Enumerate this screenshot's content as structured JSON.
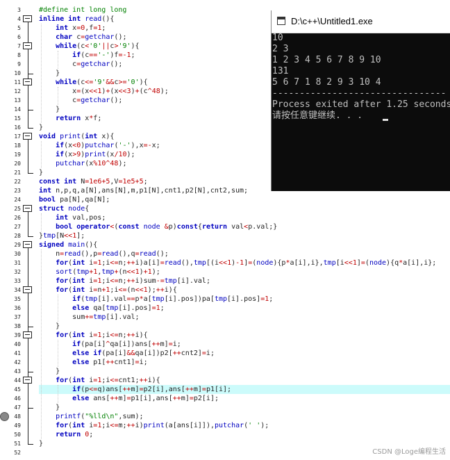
{
  "editor": {
    "code_lines": [
      {
        "n": "3",
        "text": "#define int long long"
      },
      {
        "n": "4",
        "text": "inline int read(){"
      },
      {
        "n": "5",
        "text": "    int x=0,f=1;"
      },
      {
        "n": "6",
        "text": "    char c=getchar();"
      },
      {
        "n": "7",
        "text": "    while(c<'0'||c>'9'){"
      },
      {
        "n": "8",
        "text": "        if(c=='-')f=-1;"
      },
      {
        "n": "9",
        "text": "        c=getchar();"
      },
      {
        "n": "10",
        "text": "    }"
      },
      {
        "n": "11",
        "text": "    while(c<='9'&&c>='0'){"
      },
      {
        "n": "12",
        "text": "        x=(x<<1)+(x<<3)+(c^48);"
      },
      {
        "n": "13",
        "text": "        c=getchar();"
      },
      {
        "n": "14",
        "text": "    }"
      },
      {
        "n": "15",
        "text": "    return x*f;"
      },
      {
        "n": "16",
        "text": "}"
      },
      {
        "n": "17",
        "text": "void print(int x){"
      },
      {
        "n": "18",
        "text": "    if(x<0)putchar('-'),x=-x;"
      },
      {
        "n": "19",
        "text": "    if(x>9)print(x/10);"
      },
      {
        "n": "20",
        "text": "    putchar(x%10^48);"
      },
      {
        "n": "21",
        "text": "}"
      },
      {
        "n": "22",
        "text": "const int N=1e6+5,V=1e5+5;"
      },
      {
        "n": "23",
        "text": "int n,p,q,a[N],ans[N],m,p1[N],cnt1,p2[N],cnt2,sum;"
      },
      {
        "n": "24",
        "text": "bool pa[N],qa[N];"
      },
      {
        "n": "25",
        "text": "struct node{"
      },
      {
        "n": "26",
        "text": "    int val,pos;"
      },
      {
        "n": "27",
        "text": "    bool operator<(const node &p)const{return val<p.val;}"
      },
      {
        "n": "28",
        "text": "}tmp[N<<1];"
      },
      {
        "n": "29",
        "text": "signed main(){"
      },
      {
        "n": "30",
        "text": "    n=read(),p=read(),q=read();"
      },
      {
        "n": "31",
        "text": "    for(int i=1;i<=n;++i)a[i]=read(),tmp[(i<<1)-1]=(node){p*a[i],i},tmp[i<<1]=(node){q*a[i],i};"
      },
      {
        "n": "32",
        "text": "    sort(tmp+1,tmp+(n<<1)+1);"
      },
      {
        "n": "33",
        "text": "    for(int i=1;i<=n;++i)sum-=tmp[i].val;"
      },
      {
        "n": "34",
        "text": "    for(int i=n+1;i<=(n<<1);++i){"
      },
      {
        "n": "35",
        "text": "        if(tmp[i].val==p*a[tmp[i].pos])pa[tmp[i].pos]=1;"
      },
      {
        "n": "36",
        "text": "        else qa[tmp[i].pos]=1;"
      },
      {
        "n": "37",
        "text": "        sum+=tmp[i].val;"
      },
      {
        "n": "38",
        "text": "    }"
      },
      {
        "n": "39",
        "text": "    for(int i=1;i<=n;++i){"
      },
      {
        "n": "40",
        "text": "        if(pa[i]^qa[i])ans[++m]=i;"
      },
      {
        "n": "41",
        "text": "        else if(pa[i]&&qa[i])p2[++cnt2]=i;"
      },
      {
        "n": "42",
        "text": "        else p1[++cnt1]=i;"
      },
      {
        "n": "43",
        "text": "    }"
      },
      {
        "n": "44",
        "text": "    for(int i=1;i<=cnt1;++i){"
      },
      {
        "n": "45",
        "text": "        if(p<=q)ans[++m]=p2[i],ans[++m]=p1[i];"
      },
      {
        "n": "46",
        "text": "        else ans[++m]=p1[i],ans[++m]=p2[i];"
      },
      {
        "n": "47",
        "text": "    }"
      },
      {
        "n": "48",
        "text": "    printf(\"%lld\\n\",sum);"
      },
      {
        "n": "49",
        "text": "    for(int i=1;i<=m;++i)print(a[ans[i]]),putchar(' ');"
      },
      {
        "n": "50",
        "text": "    return 0;"
      },
      {
        "n": "51",
        "text": "}"
      },
      {
        "n": "52",
        "text": ""
      }
    ],
    "highlighted_line": "45",
    "breakpoint_line": "48"
  },
  "console": {
    "title": "D:\\c++\\Untitled1.exe",
    "lines": [
      "10",
      "2 3",
      "1 2 3 4 5 6 7 8 9 10",
      "131",
      "5 6 7 1 8 2 9 3 10 4",
      "--------------------------------",
      "Process exited after 1.25 seconds",
      "请按任意键继续. . ."
    ]
  },
  "watermark": "CSDN @Loge编程生活",
  "colors": {
    "keyword": "#0000c0",
    "number": "#c00000",
    "string": "#008000",
    "current_line": "#ccfbfb",
    "console_bg": "#0c0c0c"
  }
}
